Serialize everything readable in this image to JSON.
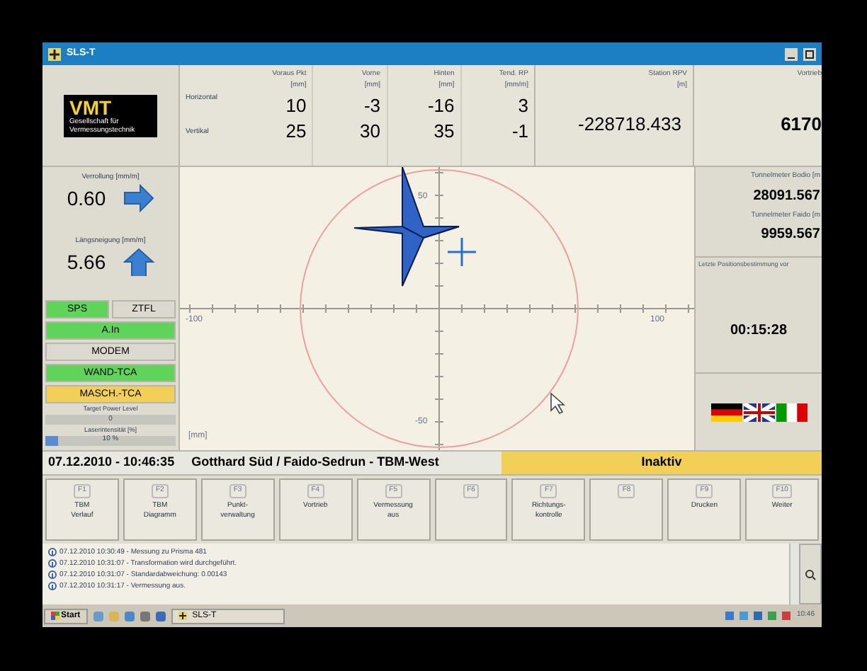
{
  "window": {
    "title": "SLS-T"
  },
  "logo": {
    "name": "VMT",
    "subtitle": "Gesellschaft für Vermessungstechnik"
  },
  "deviation_table": {
    "columns": [
      {
        "label": "Voraus Pkt",
        "unit": "[mm]"
      },
      {
        "label": "Vorne",
        "unit": "[mm]"
      },
      {
        "label": "Hinten",
        "unit": "[mm]"
      },
      {
        "label": "Tend. RP",
        "unit": "[mm/m]"
      }
    ],
    "rows": [
      {
        "label": "Horizontal",
        "values": [
          "10",
          "-3",
          "-16",
          "3"
        ]
      },
      {
        "label": "Vertikal",
        "values": [
          "25",
          "30",
          "35",
          "-1"
        ]
      }
    ]
  },
  "station": {
    "label": "Station RPV",
    "unit": "[m]",
    "value": "-228718.433"
  },
  "vortrieb": {
    "label": "Vortrieb",
    "value": "6170"
  },
  "roll": {
    "label": "Verrollung [mm/m]",
    "value": "0.60"
  },
  "pitch": {
    "label": "Längsneigung [mm/m]",
    "value": "5.66"
  },
  "indicators": [
    {
      "label": "SPS",
      "color": "#5fd35a"
    },
    {
      "label": "ZTFL",
      "color": "#dcdad0"
    },
    {
      "label": "A.In",
      "color": "#5fd35a"
    },
    {
      "label": "MODEM",
      "color": "#dcdad0"
    },
    {
      "label": "WAND-TCA",
      "color": "#5fd35a"
    },
    {
      "label": "MASCH.-TCA",
      "color": "#f2cf56"
    }
  ],
  "meters": [
    {
      "label": "Target Power Level",
      "reading": "0",
      "level": 0
    },
    {
      "label": "Laserintensität [%]",
      "reading": "10 %",
      "level": 0.1
    }
  ],
  "target_view": {
    "x_labels": [
      "-100",
      "100"
    ],
    "y_labels": [
      "50",
      "-50"
    ],
    "unit": "[mm]"
  },
  "tunnel": [
    {
      "label": "Tunnelmeter Bodio [m",
      "value": "28091.567"
    },
    {
      "label": "Tunnelmeter Faido [m",
      "value": "9959.567"
    }
  ],
  "last_position": {
    "label": "Letzte Positionsbestimmung vor",
    "value": "00:15:28"
  },
  "status_bar": {
    "datetime": "07.12.2010 - 10:46:35",
    "project": "Gotthard Süd / Faido-Sedrun - TBM-West",
    "state": "Inaktiv"
  },
  "function_keys": [
    {
      "key": "F1",
      "lines": [
        "TBM",
        "Verlauf"
      ]
    },
    {
      "key": "F2",
      "lines": [
        "TBM",
        "Diagramm"
      ]
    },
    {
      "key": "F3",
      "lines": [
        "Punkt-",
        "verwaltung"
      ]
    },
    {
      "key": "F4",
      "lines": [
        "Vortrieb"
      ]
    },
    {
      "key": "F5",
      "lines": [
        "Vermessung",
        "aus"
      ]
    },
    {
      "key": "F6"
    },
    {
      "key": "F7",
      "lines": [
        "Richtungs-",
        "kontrolle"
      ]
    },
    {
      "key": "F8"
    },
    {
      "key": "F9",
      "lines": [
        "Drucken"
      ]
    },
    {
      "key": "F10",
      "lines": [
        "Weiter"
      ]
    }
  ],
  "log": [
    "07.12.2010 10:30:49 - Messung zu Prisma 481",
    "07.12.2010 10:31:07 - Transformation wird durchgeführt.",
    "07.12.2010 10:31:07 - Standardabweichung: 0.00143",
    "07.12.2010 10:31:17 - Vermessung aus."
  ],
  "taskbar": {
    "start": "Start",
    "task": "SLS-T",
    "clock": "10:46"
  }
}
